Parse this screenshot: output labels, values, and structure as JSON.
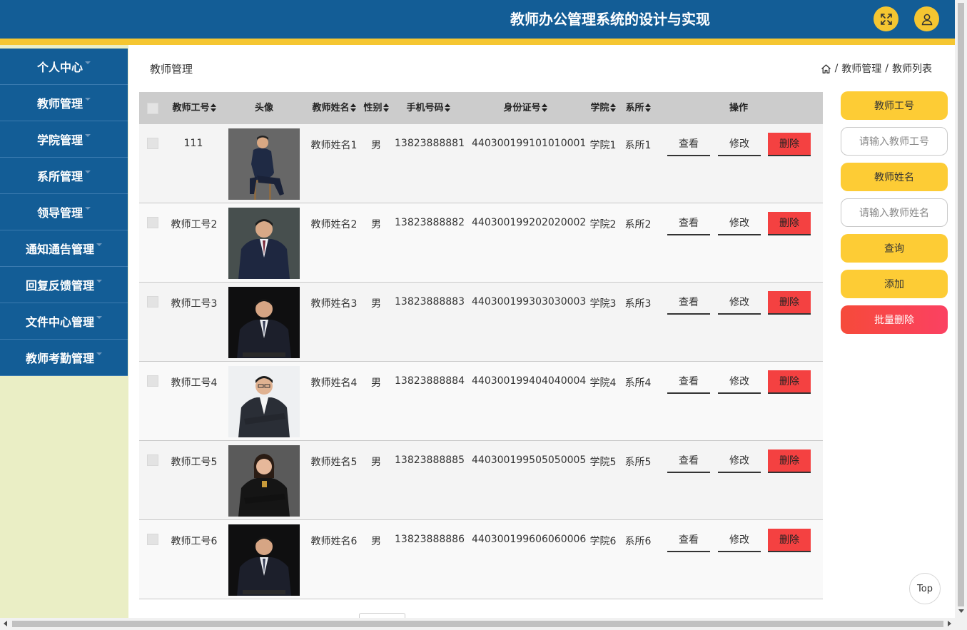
{
  "header": {
    "title": "教师办公管理系统的设计与实现",
    "icons": [
      "fullscreen-icon",
      "user-icon"
    ],
    "colors": {
      "bar": "#135d96",
      "stripe": "#f5c631"
    }
  },
  "sidebar": {
    "items": [
      {
        "label": "个人中心"
      },
      {
        "label": "教师管理"
      },
      {
        "label": "学院管理"
      },
      {
        "label": "系所管理"
      },
      {
        "label": "领导管理"
      },
      {
        "label": "通知通告管理"
      },
      {
        "label": "回复反馈管理"
      },
      {
        "label": "文件中心管理"
      },
      {
        "label": "教师考勤管理"
      }
    ]
  },
  "page": {
    "title": "教师管理",
    "breadcrumb": {
      "sep1": "/",
      "item1": "教师管理",
      "sep2": "/",
      "item2": "教师列表"
    }
  },
  "table": {
    "columns": {
      "id": "教师工号",
      "avatar": "头像",
      "name": "教师姓名",
      "gender": "性别",
      "phone": "手机号码",
      "idcard": "身份证号",
      "college": "学院",
      "dept": "系所",
      "ops": "操作"
    },
    "actions": {
      "view": "查看",
      "edit": "修改",
      "delete": "删除"
    },
    "rows": [
      {
        "id": "111",
        "name": "教师姓名1",
        "gender": "男",
        "phone": "13823888881",
        "idcard": "440300199101010001",
        "college": "学院1",
        "dept": "系所1"
      },
      {
        "id": "教师工号2",
        "name": "教师姓名2",
        "gender": "男",
        "phone": "13823888882",
        "idcard": "440300199202020002",
        "college": "学院2",
        "dept": "系所2"
      },
      {
        "id": "教师工号3",
        "name": "教师姓名3",
        "gender": "男",
        "phone": "13823888883",
        "idcard": "440300199303030003",
        "college": "学院3",
        "dept": "系所3"
      },
      {
        "id": "教师工号4",
        "name": "教师姓名4",
        "gender": "男",
        "phone": "13823888884",
        "idcard": "440300199404040004",
        "college": "学院4",
        "dept": "系所4"
      },
      {
        "id": "教师工号5",
        "name": "教师姓名5",
        "gender": "男",
        "phone": "13823888885",
        "idcard": "440300199505050005",
        "college": "学院5",
        "dept": "系所5"
      },
      {
        "id": "教师工号6",
        "name": "教师姓名6",
        "gender": "男",
        "phone": "13823888886",
        "idcard": "440300199606060006",
        "college": "学院6",
        "dept": "系所6"
      }
    ]
  },
  "search": {
    "id_label": "教师工号",
    "id_placeholder": "请输入教师工号",
    "name_label": "教师姓名",
    "name_placeholder": "请输入教师姓名",
    "query": "查询",
    "add": "添加",
    "batch_delete": "批量删除"
  },
  "top_button": "Top"
}
